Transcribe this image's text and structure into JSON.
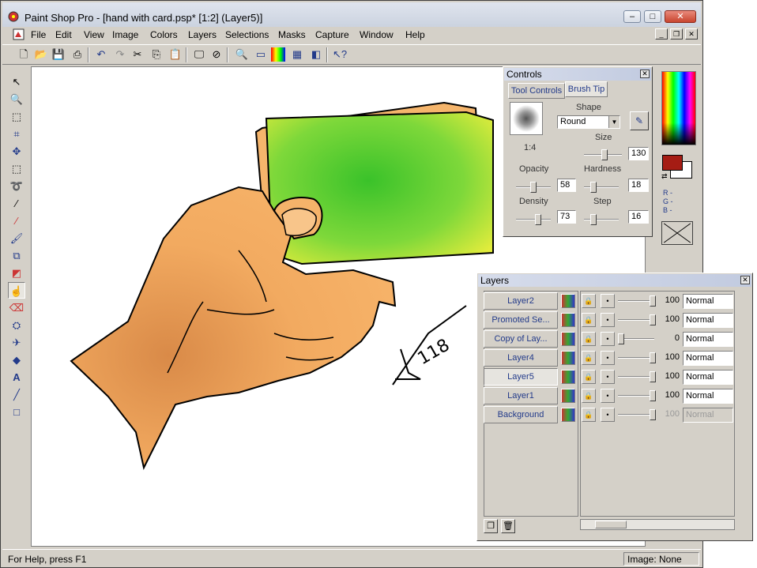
{
  "window": {
    "title": "Paint Shop Pro - [hand with card.psp* [1:2] (Layer5)]"
  },
  "menu": [
    "File",
    "Edit",
    "View",
    "Image",
    "Colors",
    "Layers",
    "Selections",
    "Masks",
    "Capture",
    "Window",
    "Help"
  ],
  "toolbar_icons": [
    "new-icon",
    "open-icon",
    "save-icon",
    "print-icon",
    "undo-icon",
    "redo-icon",
    "cut-icon",
    "copy-icon",
    "paste-icon",
    "monitor-icon",
    "no-entry-icon",
    "zoom-icon",
    "overview-icon",
    "histogram-icon",
    "color-palette-icon",
    "layers-icon",
    "context-help-icon"
  ],
  "tools": [
    "arrow",
    "zoom",
    "deform",
    "crop",
    "move",
    "selection",
    "freehand-selection",
    "magic-wand",
    "dropper",
    "paintbrush",
    "clone-brush",
    "color-replacer",
    "retouch",
    "eraser",
    "picture-tube",
    "airbrush",
    "flood-fill",
    "text",
    "draw-line",
    "preset-shapes"
  ],
  "controls": {
    "title": "Controls",
    "tabs": [
      "Tool Controls",
      "Brush Tip"
    ],
    "shape_label": "Shape",
    "shape_value": "Round",
    "ratio": "1:4",
    "size_label": "Size",
    "size": "130",
    "opacity_label": "Opacity",
    "opacity": "58",
    "hardness_label": "Hardness",
    "hardness": "18",
    "density_label": "Density",
    "density": "73",
    "step_label": "Step",
    "step": "16"
  },
  "colors": {
    "foreground": "#a51c14",
    "background": "#ffffff",
    "r": "R -",
    "g": "G -",
    "b": "B -"
  },
  "layers": {
    "title": "Layers",
    "rows": [
      {
        "name": "Layer2",
        "opacity": "100",
        "mode": "Normal"
      },
      {
        "name": "Promoted Se...",
        "opacity": "100",
        "mode": "Normal"
      },
      {
        "name": "Copy of Lay...",
        "opacity": "0",
        "mode": "Normal"
      },
      {
        "name": "Layer4",
        "opacity": "100",
        "mode": "Normal"
      },
      {
        "name": "Layer5",
        "opacity": "100",
        "mode": "Normal"
      },
      {
        "name": "Layer1",
        "opacity": "100",
        "mode": "Normal"
      },
      {
        "name": "Background",
        "opacity": "100",
        "mode": "Normal"
      }
    ]
  },
  "status": {
    "help": "For Help, press F1",
    "image": "Image: None"
  },
  "canvas": {
    "signature_text": "118"
  }
}
